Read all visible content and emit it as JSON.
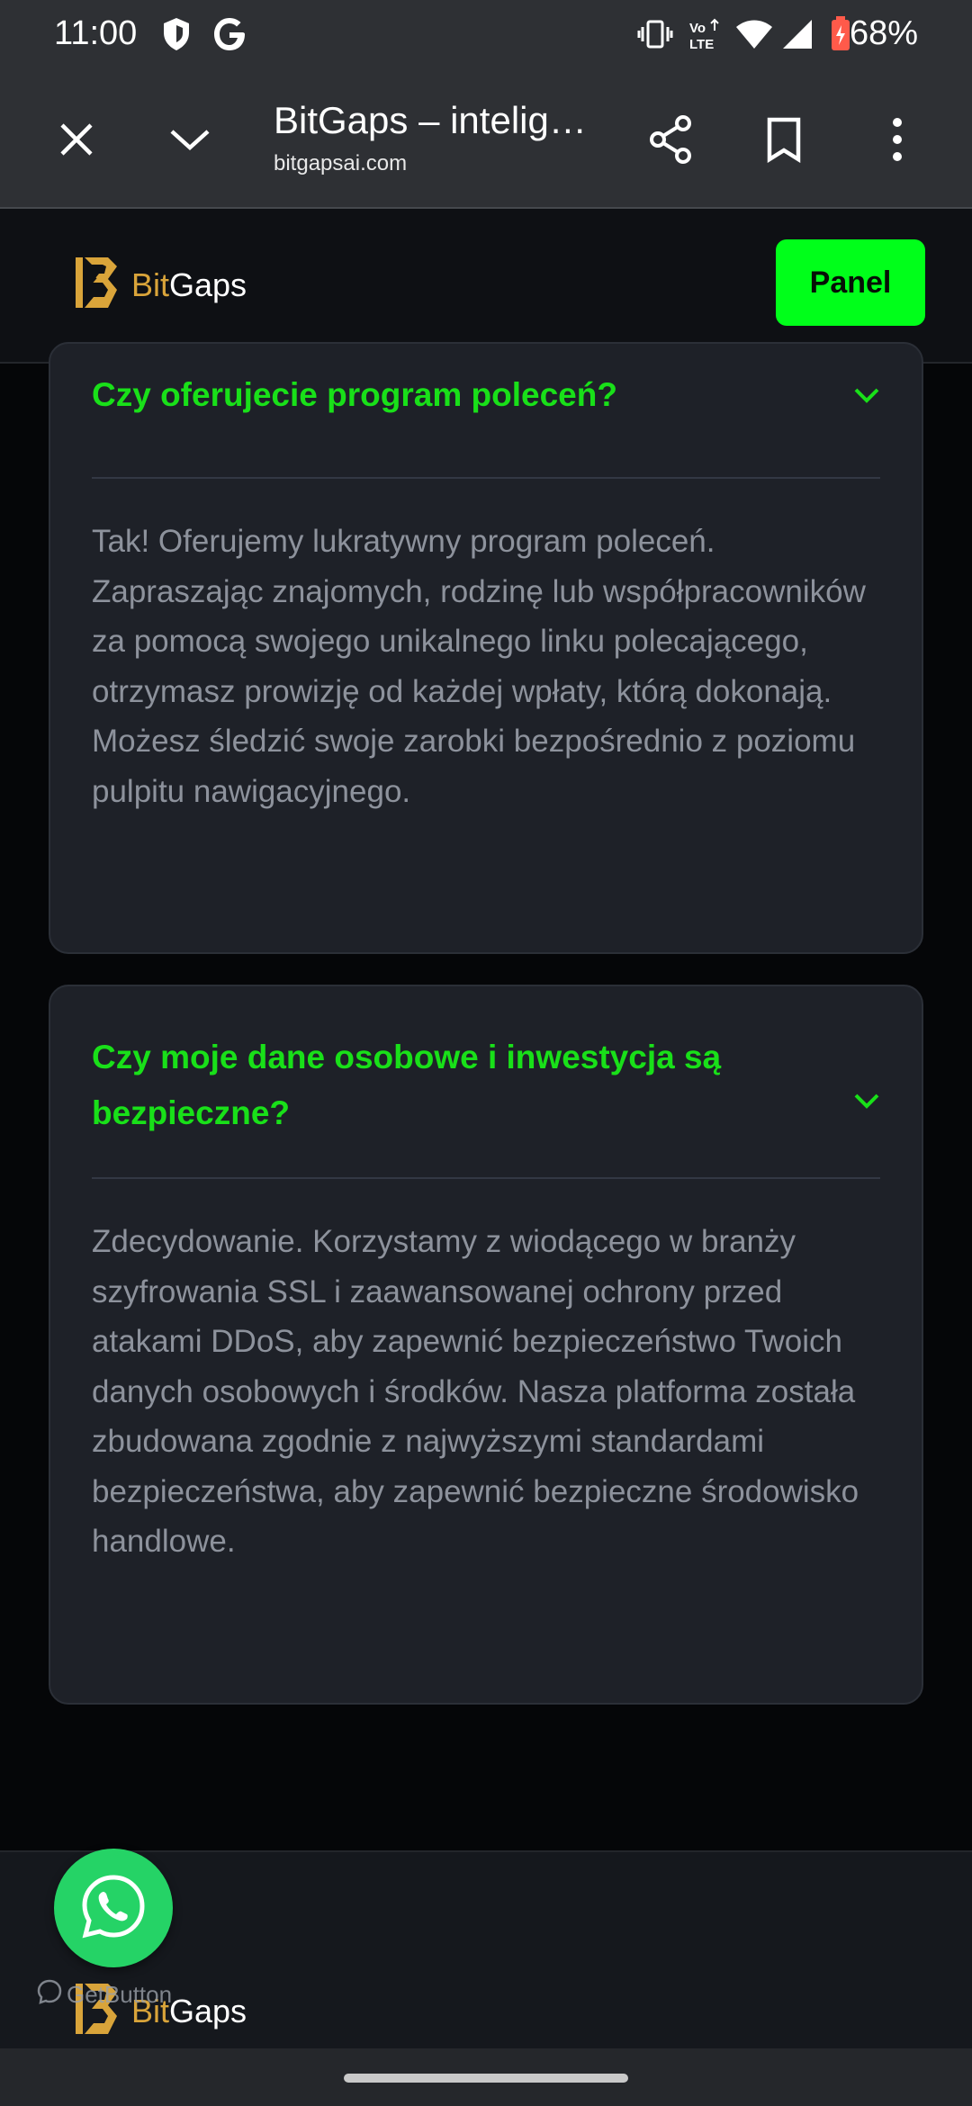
{
  "status_bar": {
    "time": "11:00",
    "battery": "68%",
    "icons": [
      "shield-icon",
      "google-icon",
      "vibrate-icon",
      "volte-icon",
      "wifi-icon",
      "signal-icon",
      "battery-icon"
    ]
  },
  "browser": {
    "title": "BitGaps – intelig…",
    "url": "bitgapsai.com",
    "icons": [
      "close-icon",
      "chevron-down-icon",
      "share-icon",
      "bookmark-icon",
      "more-icon"
    ]
  },
  "site_header": {
    "logo_bit": "Bit",
    "logo_gaps": "Gaps",
    "panel_button": "Panel"
  },
  "faq": [
    {
      "question": "Czy oferujecie program poleceń?",
      "answer": "Tak! Oferujemy lukratywny program poleceń. Zapraszając znajomych, rodzinę lub współpracowników za pomocą swojego unikalnego linku polecającego, otrzymasz prowizję od każdej wpłaty, którą dokonają. Możesz śledzić swoje zarobki bezpośrednio z poziomu pulpitu nawigacyjnego."
    },
    {
      "question": "Czy moje dane osobowe i inwestycja są bezpieczne?",
      "answer": "Zdecydowanie. Korzystamy z wiodącego w branży szyfrowania SSL i zaawansowanej ochrony przed atakami DDoS, aby zapewnić bezpieczeństwo Twoich danych osobowych i środków. Nasza platforma została zbudowana zgodnie z najwyższymi standardami bezpieczeństwa, aby zapewnić bezpieczne środowisko handlowe."
    }
  ],
  "footer": {
    "logo_bit": "Bit",
    "logo_gaps": "Gaps",
    "getbutton_label": "GetButton"
  },
  "colors": {
    "accent": "#00ff1a",
    "question": "#19e019",
    "brand_gold": "#d9a43a",
    "card_bg": "#1e2128"
  }
}
